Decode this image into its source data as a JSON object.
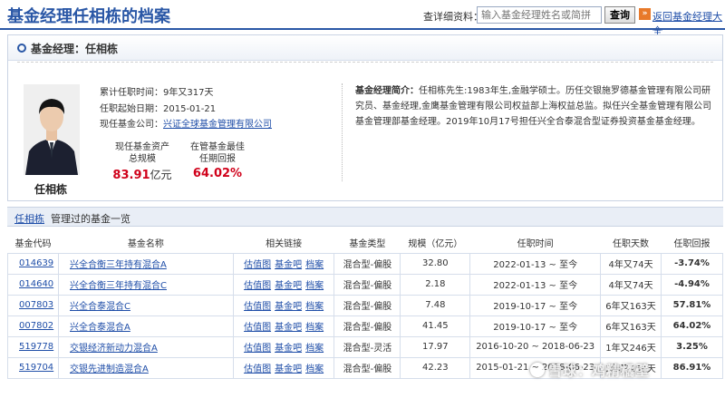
{
  "header": {
    "title": "基金经理任相栋的档案",
    "search_label": "查详细资料：",
    "search_placeholder": "输入基金经理姓名或简拼",
    "search_button": "查询",
    "back_link": "返回基金经理大全"
  },
  "manager": {
    "panel_title": "基金经理：任相栋",
    "name": "任相栋",
    "tenure_label": "累计任职时间：",
    "tenure_value": "9年又317天",
    "start_label": "任职起始日期：",
    "start_value": "2015-01-21",
    "company_label": "现任基金公司：",
    "company_value": "兴证全球基金管理有限公司",
    "assets_label_1": "现任基金资产",
    "assets_label_2": "总规模",
    "assets_value": "83.91",
    "assets_unit": "亿元",
    "best_label_1": "在管基金最佳",
    "best_label_2": "任期回报",
    "best_value": "64.02%",
    "bio_label": "基金经理简介：",
    "bio_text": "任相栋先生:1983年生,金融学硕士。历任交银施罗德基金管理有限公司研究员、基金经理,金鹰基金管理有限公司权益部上海权益总监。拟任兴全基金管理有限公司基金管理部基金经理。2019年10月17号担任兴全合泰混合型证券投资基金基金经理。"
  },
  "funds": {
    "section_name": "任相栋",
    "section_title": "管理过的基金一览",
    "columns": [
      "基金代码",
      "基金名称",
      "相关链接",
      "基金类型",
      "规模（亿元）",
      "任职时间",
      "任职天数",
      "任职回报"
    ],
    "link_labels": [
      "估值图",
      "基金吧",
      "档案"
    ],
    "rows": [
      {
        "code": "014639",
        "name": "兴全合衡三年持有混合A",
        "type": "混合型-偏股",
        "size": "32.80",
        "period": "2022-01-13 ~ 至今",
        "days": "4年又74天",
        "return": "-3.74%",
        "dir": "neg"
      },
      {
        "code": "014640",
        "name": "兴全合衡三年持有混合C",
        "type": "混合型-偏股",
        "size": "2.18",
        "period": "2022-01-13 ~ 至今",
        "days": "4年又74天",
        "return": "-4.94%",
        "dir": "neg"
      },
      {
        "code": "007803",
        "name": "兴全合泰混合C",
        "type": "混合型-偏股",
        "size": "7.48",
        "period": "2019-10-17 ~ 至今",
        "days": "6年又163天",
        "return": "57.81%",
        "dir": "pos"
      },
      {
        "code": "007802",
        "name": "兴全合泰混合A",
        "type": "混合型-偏股",
        "size": "41.45",
        "period": "2019-10-17 ~ 至今",
        "days": "6年又163天",
        "return": "64.02%",
        "dir": "pos"
      },
      {
        "code": "519778",
        "name": "交银经济新动力混合A",
        "type": "混合型-灵活",
        "size": "17.97",
        "period": "2016-10-20 ~ 2018-06-23",
        "days": "1年又246天",
        "return": "3.25%",
        "dir": "pos"
      },
      {
        "code": "519704",
        "name": "交银先进制造混合A",
        "type": "混合型-偏股",
        "size": "42.23",
        "period": "2015-01-21 ~ 2018-06-23",
        "days": "3年又154天",
        "return": "86.91%",
        "dir": "pos"
      }
    ]
  },
  "watermark": "雪球：鸡精橘壁"
}
